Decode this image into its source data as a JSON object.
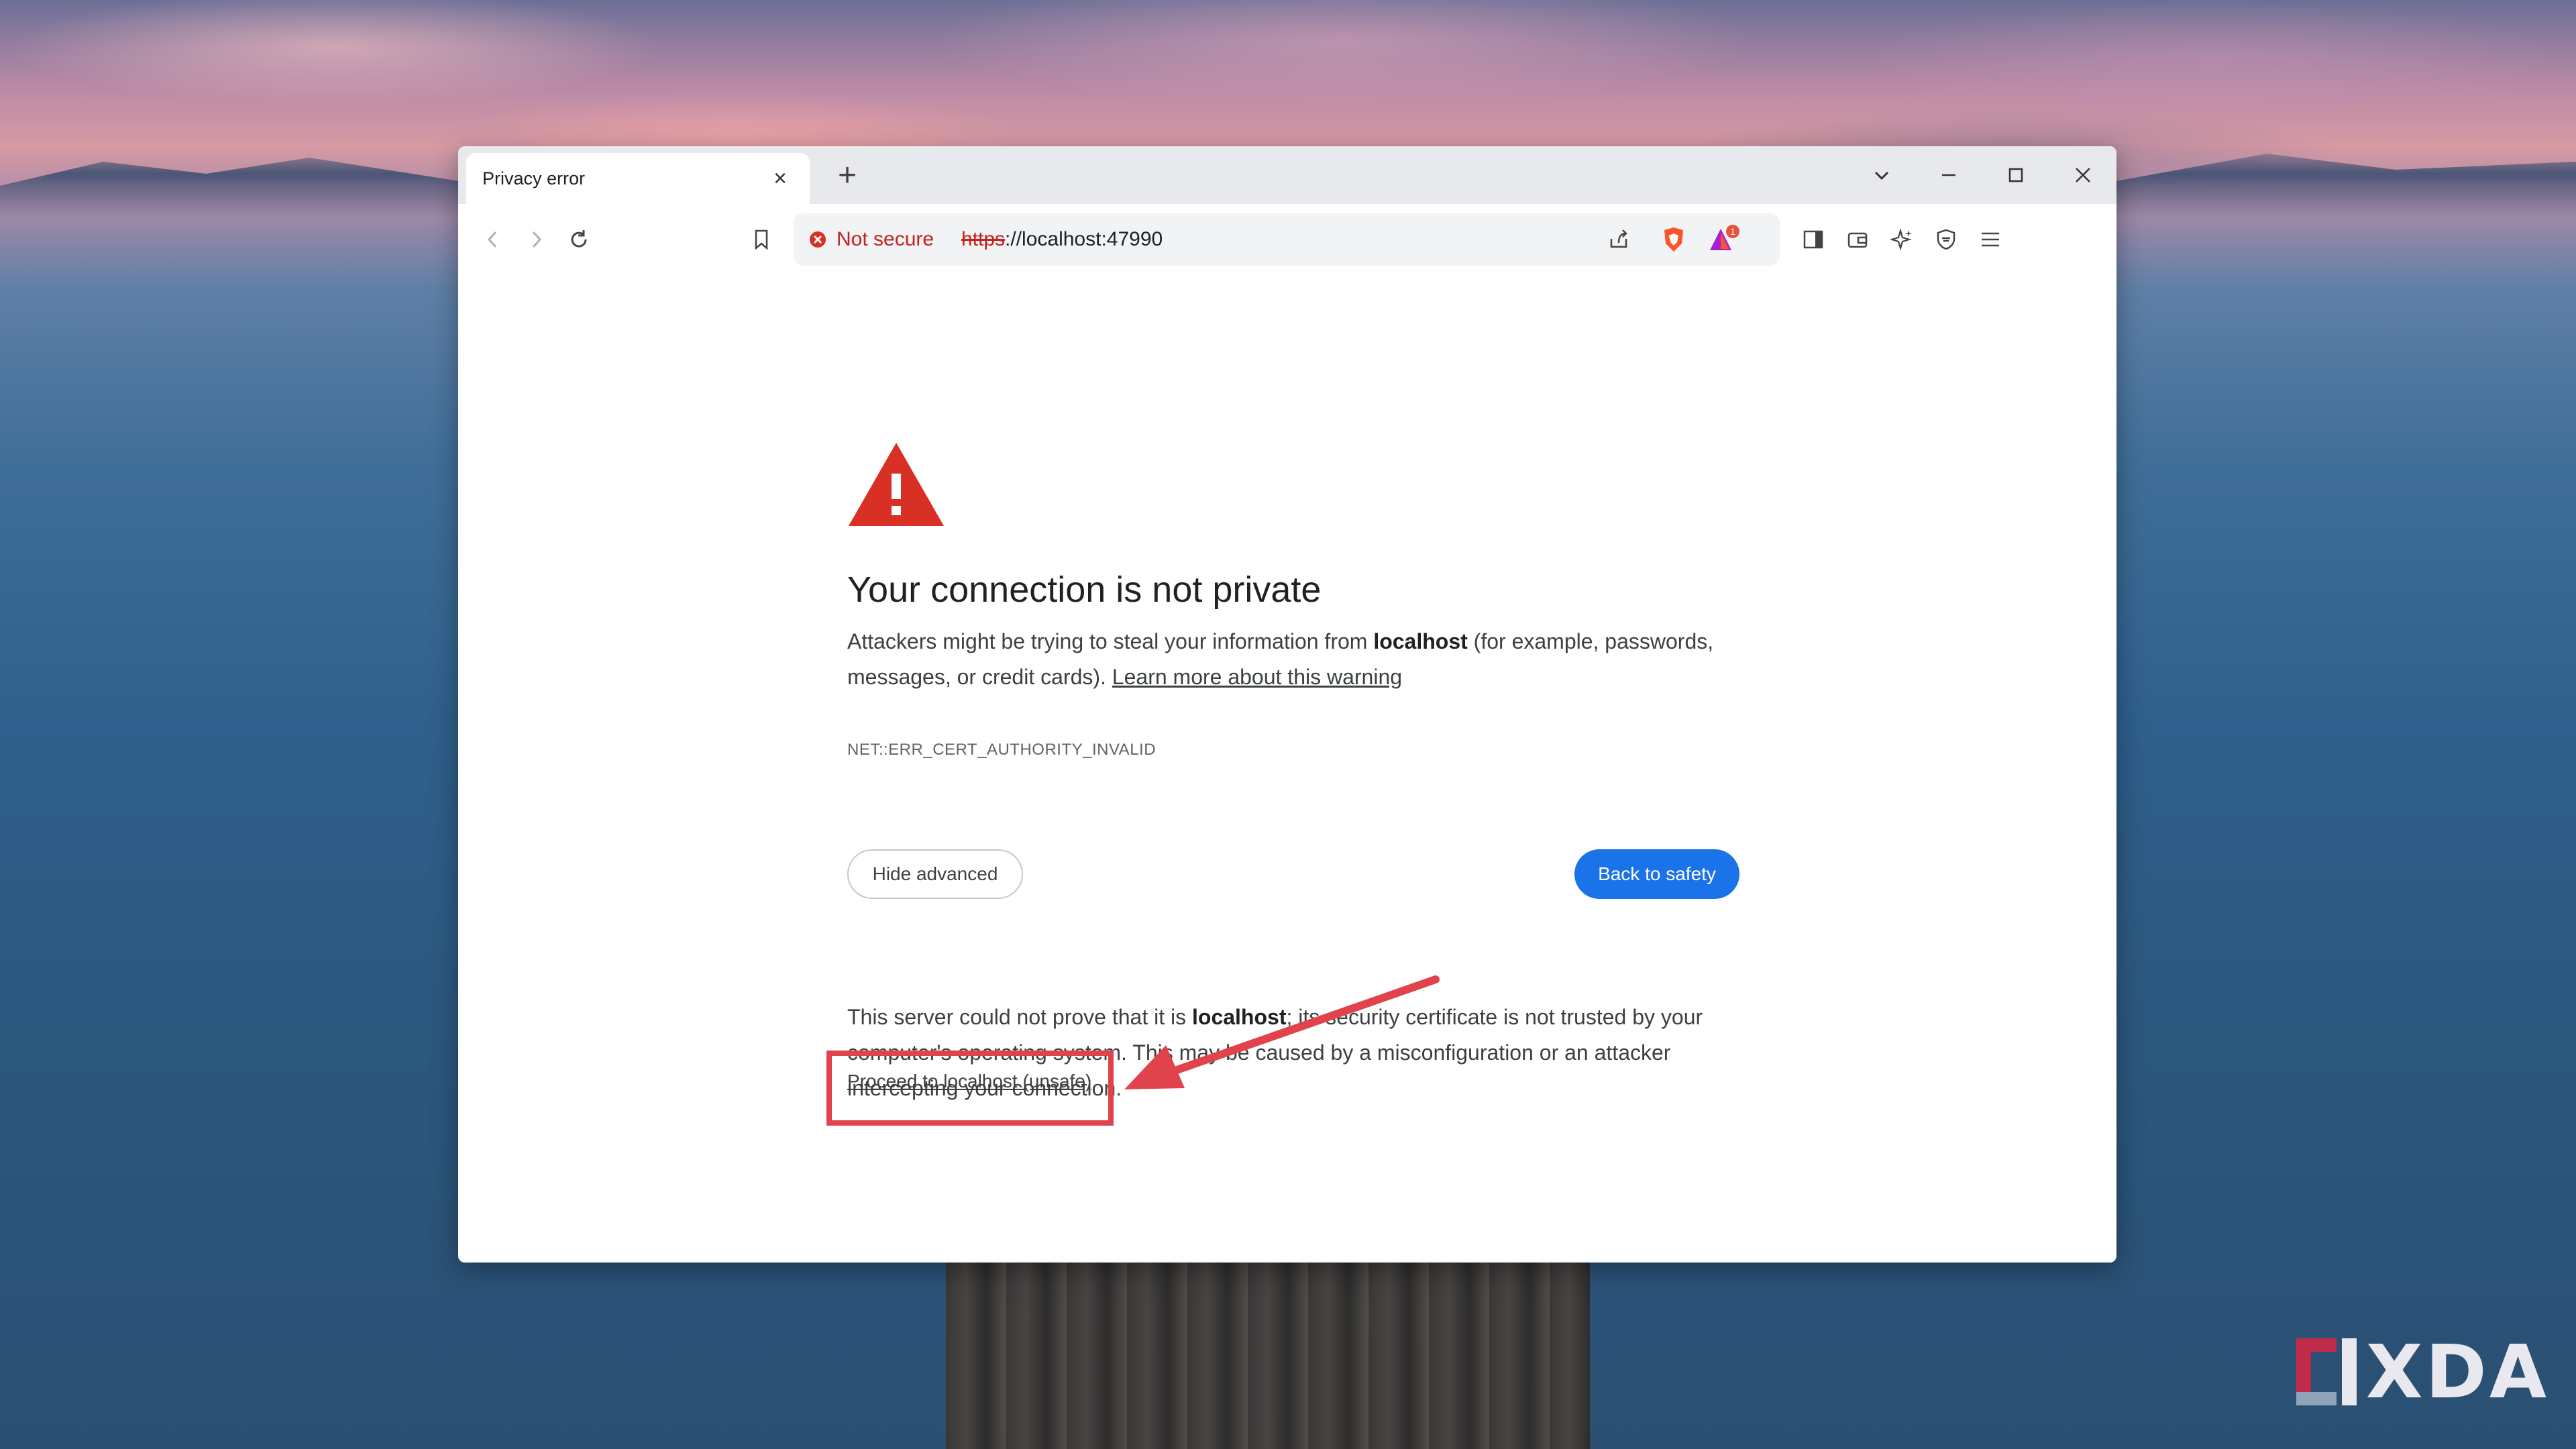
{
  "browser": {
    "tab_title": "Privacy error",
    "tab_close": "×",
    "new_tab": "+",
    "not_secure": "Not secure",
    "url_scheme": "https",
    "url_rest": "://localhost:47990",
    "notification_count": "1"
  },
  "page": {
    "heading": "Your connection is not private",
    "para1_a": "Attackers might be trying to steal your information from ",
    "para1_host": "localhost",
    "para1_b": " (for example, passwords, messages, or credit cards). ",
    "learn_more": "Learn more about this warning",
    "error_code": "NET::ERR_CERT_AUTHORITY_INVALID",
    "hide_advanced": "Hide advanced",
    "back_to_safety": "Back to safety",
    "para2_a": "This server could not prove that it is ",
    "para2_host": "localhost",
    "para2_b": "; its security certificate is not trusted by your computer's operating system. This may be caused by a misconfiguration or an attacker intercepting your connection.",
    "proceed": "Proceed to localhost (unsafe)"
  },
  "watermark": {
    "text": "XDA"
  },
  "colors": {
    "accent_blue": "#1a73e8",
    "warning_red": "#d93025",
    "annotation_red": "#e0434c"
  },
  "icons": [
    "back-icon",
    "forward-icon",
    "reload-icon",
    "bookmark-icon",
    "not-secure-icon",
    "share-icon",
    "brave-shield-icon",
    "brave-rewards-icon",
    "sidebar-icon",
    "wallet-icon",
    "leo-ai-icon",
    "vpn-icon",
    "menu-icon",
    "tab-search-icon",
    "minimize-icon",
    "maximize-icon",
    "close-icon",
    "warning-icon"
  ]
}
